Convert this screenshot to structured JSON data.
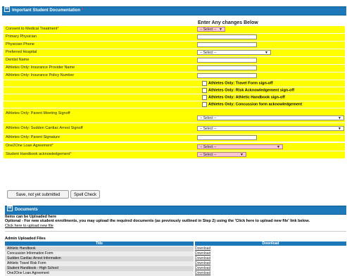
{
  "section1": {
    "title": "Important Student Documentation",
    "required_star": "*",
    "toggle": "⊟",
    "changes_header": "Enter Any changes Below"
  },
  "rows": [
    {
      "label": "Consent to Medical Treatment",
      "required": "*",
      "control": "select",
      "value": "-- Select --",
      "style": "pink",
      "width": 40
    },
    {
      "label": "Primary Physician",
      "control": "text"
    },
    {
      "label": "Physician Phone",
      "control": "text"
    },
    {
      "label": "Preferred Hospital",
      "control": "select",
      "value": "-- Select --",
      "style": "white",
      "width": 105
    },
    {
      "label": "Dentist Name",
      "control": "text"
    },
    {
      "label": "Athletes Only: Insurance Provider Name",
      "control": "text"
    },
    {
      "label": "Athletes Only: Insurance Policy Number",
      "control": "text"
    },
    {
      "label": "",
      "control": "checkbox",
      "value": "Athletes Only: Travel Form sign-off"
    },
    {
      "label": "",
      "control": "checkbox",
      "value": "Athletes Only: Risk Acknowledgement sign-off"
    },
    {
      "label": "",
      "control": "checkbox",
      "value": "Athletes Only: Athletic Handbook sign-off"
    },
    {
      "label": "",
      "control": "checkbox",
      "value": "Athletes Only: Concussion form acknowledgement"
    },
    {
      "label": "Athletes Only: Parent Meeting Signoff",
      "control": "select",
      "value": "-- Select --",
      "style": "white",
      "width": 213,
      "tall": true
    },
    {
      "label": "Athletes Only: Sudden Cardiac Arrest Signoff",
      "control": "select",
      "value": "-- Select --",
      "style": "white",
      "width": 213,
      "tall": true
    },
    {
      "label": "Athletes Only: Parent Signature",
      "control": "text"
    },
    {
      "label": "One2One Loan Agreement",
      "required": "*",
      "control": "select",
      "value": "-- Select --",
      "style": "pink",
      "width": 122
    },
    {
      "label": "Student Handbook acknowledgement",
      "required": "*",
      "control": "select",
      "value": "-- Select --",
      "style": "pink",
      "width": 70
    }
  ],
  "buttons": {
    "save": "Save, not yet submitted",
    "spell": "Spell Check"
  },
  "section2": {
    "title": "Documents",
    "toggle": "⊟",
    "line1": "Items can be Uploaded here",
    "line2": "Optional - For new student enrollments, you may upload the required documents (as previously outlined in Step 2) using the 'Click here to upload new file' link below.",
    "upload_link": "Click here to upload new file",
    "admin_heading": "Admin Uploaded Files"
  },
  "table": {
    "col_title": "Title",
    "col_download": "Download",
    "rows": [
      {
        "title": "Athletic Handbook",
        "download": "Download"
      },
      {
        "title": "Concussion Information Form",
        "download": "Download"
      },
      {
        "title": "Sudden Cardiac Arrest Information",
        "download": "Download"
      },
      {
        "title": "Athletic Travel Risk Form",
        "download": "Download"
      },
      {
        "title": "Student Handbook - High School",
        "download": "Download"
      },
      {
        "title": "One2One Loan Agreement",
        "download": "Download"
      }
    ]
  }
}
